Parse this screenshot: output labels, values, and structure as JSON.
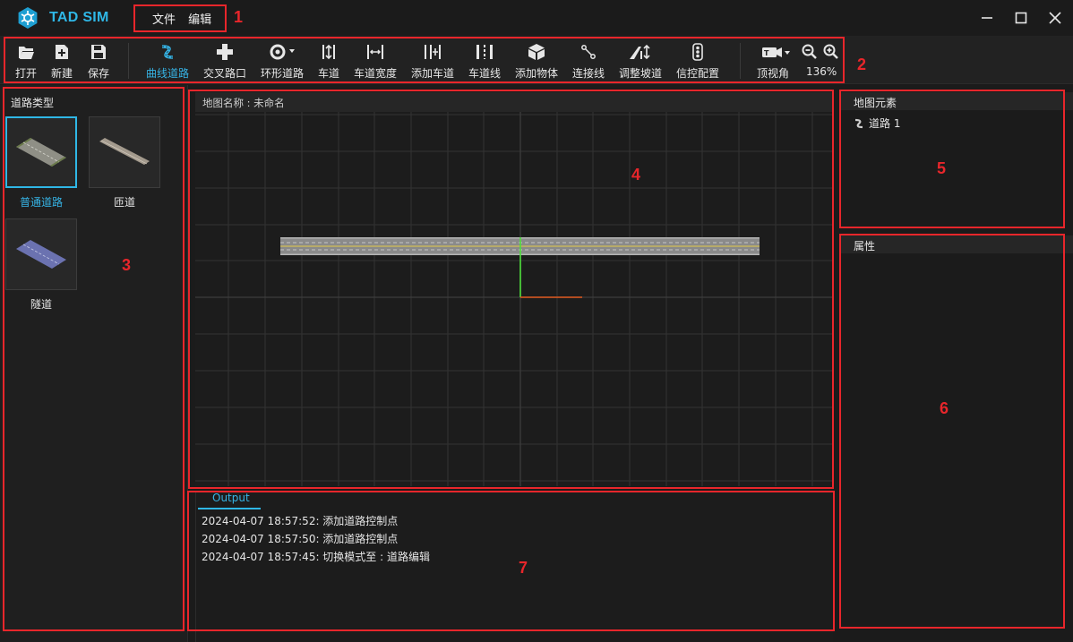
{
  "app": {
    "title": "TAD SIM"
  },
  "menu": {
    "items": [
      "文件",
      "编辑"
    ]
  },
  "toolbar": {
    "buttons": [
      {
        "label": "打开",
        "icon": "folder-open-icon"
      },
      {
        "label": "新建",
        "icon": "new-file-icon"
      },
      {
        "label": "保存",
        "icon": "save-icon"
      },
      {
        "label": "曲线道路",
        "icon": "curve-road-icon",
        "active": true
      },
      {
        "label": "交叉路口",
        "icon": "junction-icon"
      },
      {
        "label": "环形道路",
        "icon": "roundabout-icon"
      },
      {
        "label": "车道",
        "icon": "lane-icon"
      },
      {
        "label": "车道宽度",
        "icon": "lane-width-icon"
      },
      {
        "label": "添加车道",
        "icon": "add-lane-icon"
      },
      {
        "label": "车道线",
        "icon": "lane-line-icon"
      },
      {
        "label": "添加物体",
        "icon": "add-object-icon"
      },
      {
        "label": "连接线",
        "icon": "connect-line-icon"
      },
      {
        "label": "调整坡道",
        "icon": "slope-icon"
      },
      {
        "label": "信控配置",
        "icon": "traffic-light-icon"
      },
      {
        "label": "顶视角",
        "icon": "top-view-icon"
      }
    ],
    "zoom": "136%"
  },
  "left_panel": {
    "title": "道路类型",
    "items": [
      {
        "label": "普通道路",
        "selected": true
      },
      {
        "label": "匝道",
        "selected": false
      },
      {
        "label": "隧道",
        "selected": false
      }
    ]
  },
  "viewport": {
    "map_name": "地图名称 : 未命名"
  },
  "map_elements": {
    "title": "地图元素",
    "items": [
      "道路 1"
    ]
  },
  "properties": {
    "title": "属性"
  },
  "output": {
    "tab": "Output",
    "logs": [
      "2024-04-07 18:57:52: 添加道路控制点",
      "2024-04-07 18:57:50: 添加道路控制点",
      "2024-04-07 18:57:45: 切换模式至 : 道路编辑"
    ]
  },
  "annotations": [
    "1",
    "2",
    "3",
    "4",
    "5",
    "6",
    "7"
  ],
  "colors": {
    "accent": "#2fb7e6",
    "annotation": "#e8262b",
    "background": "#1b1b1b"
  }
}
